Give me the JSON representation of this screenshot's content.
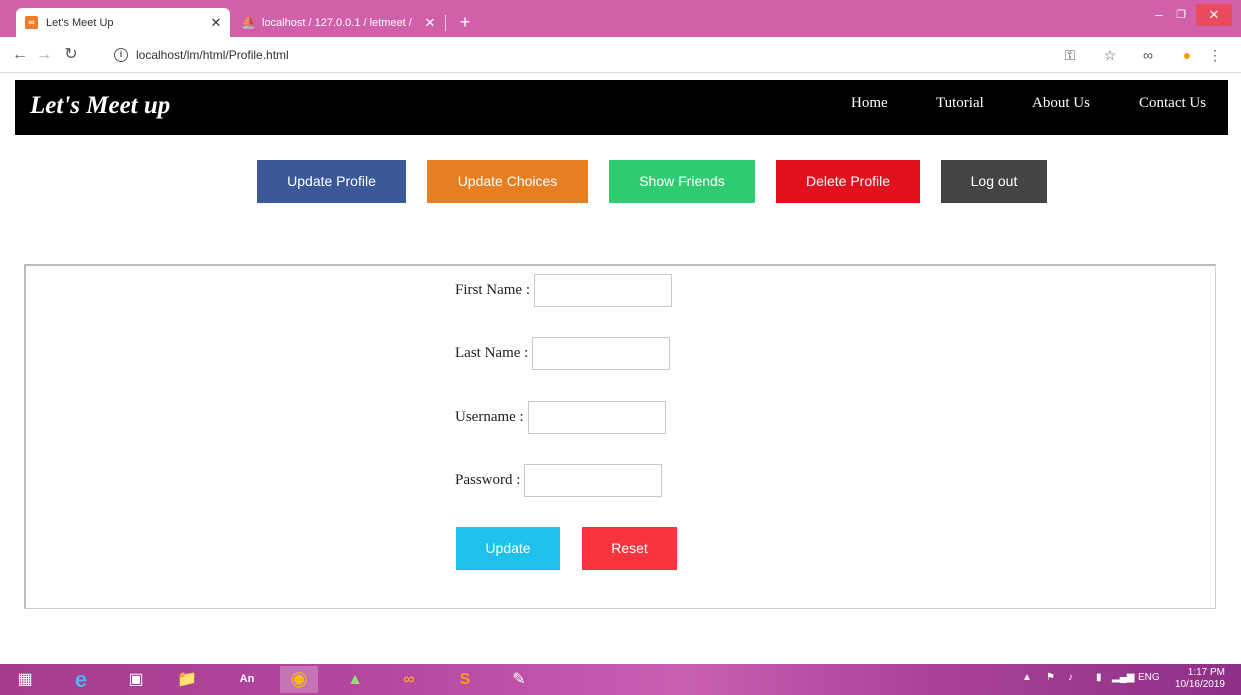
{
  "browser": {
    "tabs": [
      {
        "title": "Let's Meet Up",
        "favicon": "xampp-icon",
        "active": true
      },
      {
        "title": "localhost / 127.0.0.1 / letmeet / ",
        "favicon": "phpmyadmin-icon",
        "active": false
      }
    ],
    "url": "localhost/lm/html/Profile.html"
  },
  "site": {
    "brand": "Let's Meet up",
    "nav": [
      "Home",
      "Tutorial",
      "About Us",
      "Contact Us"
    ]
  },
  "actions": [
    {
      "label": "Update Profile",
      "color": "#3b5998"
    },
    {
      "label": "Update Choices",
      "color": "#e67e22"
    },
    {
      "label": "Show Friends",
      "color": "#2ecc71"
    },
    {
      "label": "Delete Profile",
      "color": "#e3111e"
    },
    {
      "label": "Log out",
      "color": "#444444"
    }
  ],
  "form": {
    "first_name_label": "First Name :",
    "last_name_label": "Last Name :",
    "username_label": "Username :",
    "password_label": "Password :",
    "first_name_value": "",
    "last_name_value": "",
    "username_value": "",
    "password_value": "",
    "update_label": "Update",
    "update_color": "#1ec0ec",
    "reset_label": "Reset",
    "reset_color": "#f9343f"
  },
  "taskbar": {
    "language": "ENG",
    "time": "1:17 PM",
    "date": "10/16/2019"
  }
}
